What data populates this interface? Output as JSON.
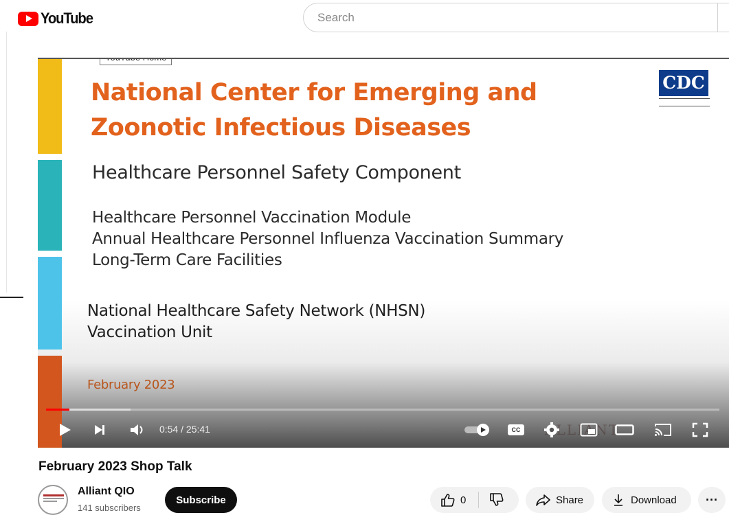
{
  "header": {
    "logo_text": "YouTube",
    "search_placeholder": "Search"
  },
  "player": {
    "tooltip": "YouTube Home",
    "slide": {
      "title_line1": "National Center for Emerging and",
      "title_line2": "Zoonotic Infectious Diseases",
      "component": "Healthcare Personnel Safety Component",
      "module_line1": "Healthcare Personnel Vaccination Module",
      "module_line2": "Annual Healthcare Personnel Influenza Vaccination Summary",
      "module_line3": "Long-Term Care Facilities",
      "network_line1": "National Healthcare Safety Network (NHSN)",
      "network_line2": "Vaccination Unit",
      "date": "February 2023",
      "logo_text": "CDC"
    },
    "progress": {
      "played_fraction": 0.035,
      "buffered_fraction": 0.125
    },
    "time_display": "0:54 / 25:41",
    "icons": [
      "play-icon",
      "next-icon",
      "volume-icon",
      "autoplay-toggle-icon",
      "captions-icon",
      "settings-icon",
      "miniplayer-icon",
      "theater-icon",
      "cast-icon",
      "fullscreen-icon"
    ],
    "captions_label": "CC",
    "colors": {
      "accent": "#ff0000",
      "title_orange": "#e2621d",
      "cdc_blue": "#0e3c8a"
    }
  },
  "video": {
    "title": "February 2023 Shop Talk",
    "channel_name": "Alliant QIO",
    "subscribers": "141 subscribers",
    "subscribe_label": "Subscribe",
    "like_count": "0",
    "share_label": "Share",
    "download_label": "Download",
    "more_label": "···"
  }
}
